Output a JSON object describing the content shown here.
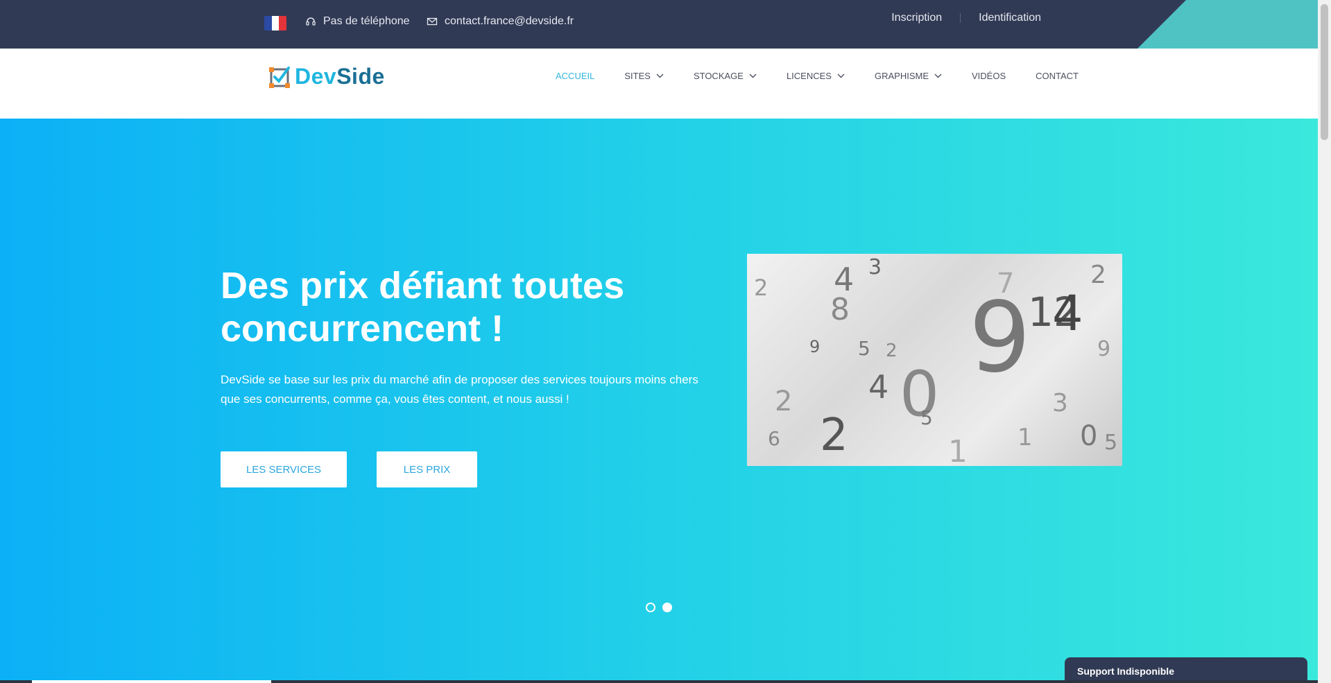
{
  "topbar": {
    "phone_text": "Pas de téléphone",
    "email_text": "contact.france@devside.fr",
    "inscription_label": "Inscription",
    "identification_label": "Identification",
    "colors": {
      "background": "#313a54",
      "corner": "#4fc2c4"
    },
    "flag_icon": "flag-france-icon"
  },
  "logo": {
    "dev": "Dev",
    "side": "Side"
  },
  "menu": {
    "items": [
      {
        "label": "ACCUEIL",
        "active": true,
        "dropdown": false
      },
      {
        "label": "SITES",
        "active": false,
        "dropdown": true
      },
      {
        "label": "STOCKAGE",
        "active": false,
        "dropdown": true
      },
      {
        "label": "LICENCES",
        "active": false,
        "dropdown": true
      },
      {
        "label": "GRAPHISME",
        "active": false,
        "dropdown": true
      },
      {
        "label": "VIDÉOS",
        "active": false,
        "dropdown": false
      },
      {
        "label": "CONTACT",
        "active": false,
        "dropdown": false
      }
    ],
    "active_color": "#31b6dd"
  },
  "hero": {
    "title": "Des prix défiant toutes concurrencent !",
    "description": "DevSide se base sur les prix du marché afin de proposer des services toujours moins chers que ses concurrents, comme ça, vous êtes content, et nous aussi !",
    "button_services": "LES SERVICES",
    "button_prix": "LES PRIX",
    "slides_total": 2,
    "slide_active": 2,
    "gradient": [
      "#0bb0f6",
      "#3ae8dc"
    ]
  },
  "support": {
    "label": "Support Indisponible"
  }
}
